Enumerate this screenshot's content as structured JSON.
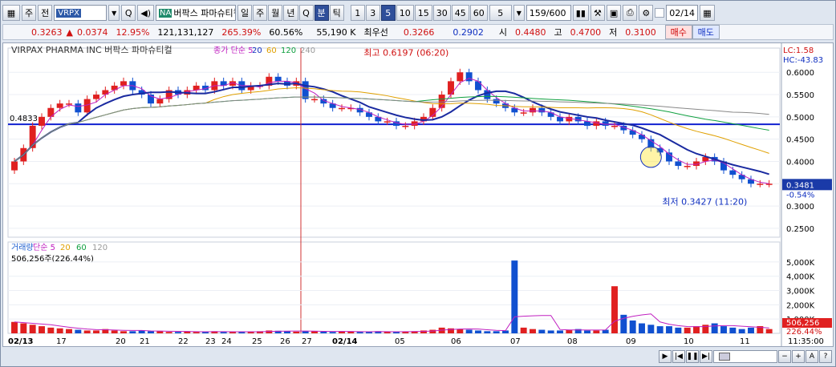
{
  "toolbar": {
    "b1": "주",
    "b2": "전",
    "code": "VRPX",
    "search": "Q",
    "sound": "◀)",
    "na": "NA",
    "name": "버팍스 파마슈티컬",
    "periods": [
      "일",
      "주",
      "월",
      "년",
      "Q",
      "분",
      "틱"
    ],
    "active_period": "분",
    "intervals": [
      "1",
      "3",
      "5",
      "10",
      "15",
      "30",
      "45",
      "60"
    ],
    "active_interval": "5",
    "custom_interval": "5",
    "count": "159",
    "max": "/600",
    "date": "02/14"
  },
  "quote": {
    "price": "0.3263",
    "arrow": "▲",
    "change": "0.0374",
    "pct": "12.95%",
    "volume": "121,131,127",
    "vol_pct": "265.39%",
    "ratio": "60.56%",
    "size": "55,190 K",
    "label_best": "최우선",
    "best_ask": "0.3266",
    "best_bid": "0.2902",
    "label_open": "시",
    "open": "0.4480",
    "label_high": "고",
    "high": "0.4700",
    "label_low": "저",
    "low": "0.3100",
    "buy": "매수",
    "sell": "매도"
  },
  "chart": {
    "title": "VIRPAX PHARMA INC  버팍스 파마슈티컬",
    "legend_price": [
      {
        "t": "종가 단순 5",
        "c": "#c020c0"
      },
      {
        "t": "20",
        "c": "#1030c0"
      },
      {
        "t": "60",
        "c": "#e0a000"
      },
      {
        "t": "120",
        "c": "#10a040"
      },
      {
        "t": "240",
        "c": "#999999"
      }
    ],
    "lc": "LC:1.58",
    "hc": "HC:-43.83",
    "hline_label": "0.4833",
    "high_annot": "최고 0.6197 (06:20)",
    "low_annot": "최저 0.3427 (11:20)",
    "last_price": "0.3481",
    "last_pct": "-0.54%",
    "price_ticks": [
      "0.6000",
      "0.5500",
      "0.5000",
      "0.4500",
      "0.4000",
      "0.3500",
      "0.3000",
      "0.2500"
    ],
    "vol_legend": [
      {
        "t": "거래량",
        "c": "#2060d0"
      },
      {
        "t": "단순 5",
        "c": "#c020c0"
      },
      {
        "t": "20",
        "c": "#e0a000"
      },
      {
        "t": "60",
        "c": "#10a040"
      },
      {
        "t": "120",
        "c": "#999999"
      }
    ],
    "vol_info": "506,256주(226.44%)",
    "vol_ticks": [
      "5,000K",
      "4,000K",
      "3,000K",
      "2,000K",
      "1,000K"
    ],
    "vol_last": "506,256",
    "vol_last_pct": "226.44%",
    "x_labels": [
      "02/13",
      "17",
      "20",
      "21",
      "22",
      "23",
      "24",
      "25",
      "26",
      "27",
      "02/14",
      "05",
      "06",
      "07",
      "08",
      "09",
      "10",
      "11"
    ],
    "time": "11:35:00"
  },
  "chart_data": {
    "type": "candlestick",
    "title": "VIRPAX PHARMA INC  버팍스 파마슈티컬",
    "xlabel": "",
    "ylabel": "",
    "ylim": [
      0.23,
      0.64
    ],
    "horizontal_line": 0.4833,
    "high": {
      "value": 0.6197,
      "time": "06:20"
    },
    "low": {
      "value": 0.3427,
      "time": "11:20"
    },
    "last": 0.3481,
    "close": [
      0.4,
      0.43,
      0.48,
      0.5,
      0.52,
      0.53,
      0.53,
      0.51,
      0.54,
      0.55,
      0.56,
      0.57,
      0.58,
      0.56,
      0.55,
      0.53,
      0.54,
      0.56,
      0.55,
      0.56,
      0.57,
      0.56,
      0.58,
      0.57,
      0.58,
      0.56,
      0.57,
      0.57,
      0.59,
      0.58,
      0.57,
      0.58,
      0.54,
      0.54,
      0.53,
      0.52,
      0.52,
      0.52,
      0.51,
      0.5,
      0.49,
      0.49,
      0.48,
      0.48,
      0.49,
      0.5,
      0.52,
      0.55,
      0.58,
      0.6,
      0.58,
      0.56,
      0.54,
      0.53,
      0.52,
      0.51,
      0.51,
      0.52,
      0.51,
      0.5,
      0.49,
      0.5,
      0.49,
      0.48,
      0.49,
      0.48,
      0.48,
      0.47,
      0.46,
      0.45,
      0.43,
      0.42,
      0.4,
      0.39,
      0.39,
      0.4,
      0.41,
      0.4,
      0.38,
      0.37,
      0.36,
      0.35,
      0.35,
      0.35
    ],
    "volume": [
      800,
      700,
      600,
      500,
      400,
      350,
      300,
      250,
      200,
      200,
      300,
      200,
      150,
      150,
      200,
      150,
      150,
      100,
      100,
      150,
      100,
      100,
      150,
      100,
      100,
      120,
      100,
      150,
      200,
      180,
      150,
      120,
      150,
      160,
      120,
      100,
      150,
      120,
      100,
      100,
      150,
      120,
      100,
      120,
      150,
      200,
      250,
      400,
      350,
      300,
      250,
      200,
      150,
      150,
      200,
      5100,
      400,
      300,
      250,
      200,
      200,
      250,
      300,
      200,
      200,
      250,
      3300,
      1300,
      900,
      700,
      600,
      500,
      500,
      400,
      400,
      500,
      600,
      700,
      500,
      400,
      300,
      400,
      506,
      300
    ]
  }
}
